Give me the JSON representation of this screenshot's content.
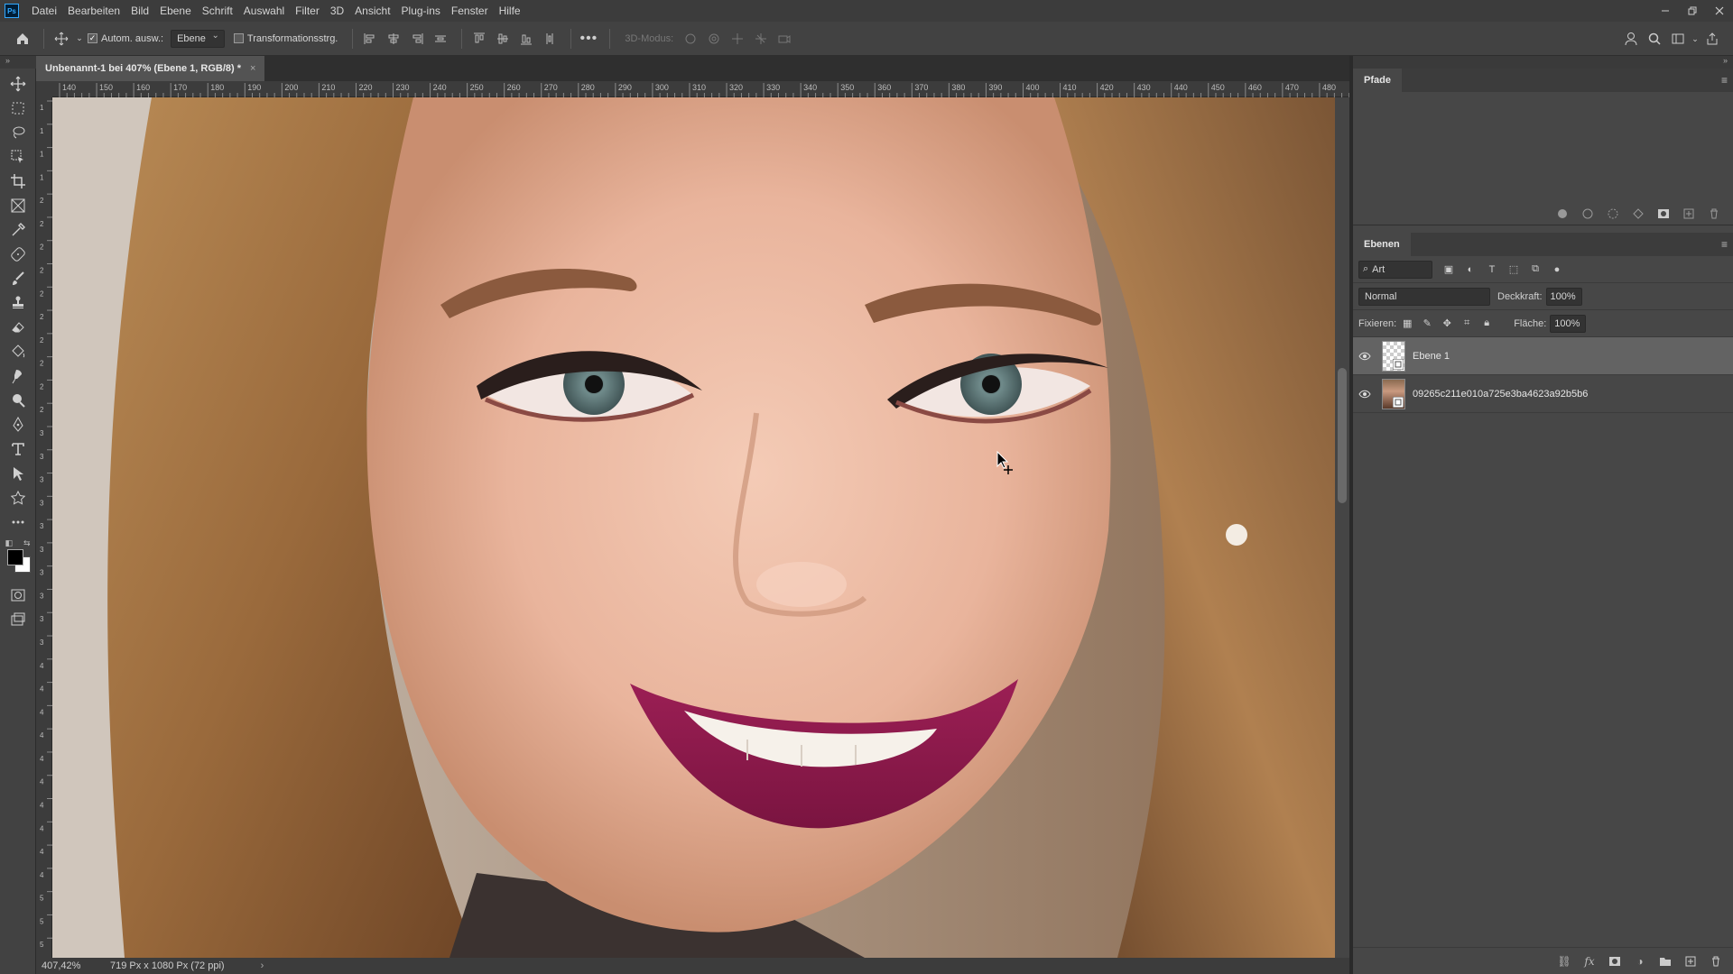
{
  "menubar": {
    "logo": "Ps",
    "items": [
      "Datei",
      "Bearbeiten",
      "Bild",
      "Ebene",
      "Schrift",
      "Auswahl",
      "Filter",
      "3D",
      "Ansicht",
      "Plug-ins",
      "Fenster",
      "Hilfe"
    ]
  },
  "optionsbar": {
    "auto_select_label": "Autom. ausw.:",
    "auto_select_checked": true,
    "auto_select_target": "Ebene",
    "transform_label": "Transformationsstrg.",
    "mode_3d_label": "3D-Modus:"
  },
  "document": {
    "tab_title": "Unbenannt-1 bei 407% (Ebene 1, RGB/8) *",
    "tab_close": "×",
    "ruler_h_labels": [
      "140",
      "150",
      "160",
      "170",
      "180",
      "190",
      "200",
      "210",
      "220",
      "230",
      "240",
      "250",
      "260",
      "270",
      "280",
      "290",
      "300",
      "310",
      "320",
      "330",
      "340",
      "350",
      "360",
      "370",
      "380",
      "390",
      "400",
      "410",
      "420",
      "430",
      "440",
      "450",
      "460",
      "470",
      "480"
    ],
    "ruler_v_labels": [
      "1",
      "1",
      "1",
      "1",
      "2",
      "2",
      "2",
      "2",
      "2",
      "2",
      "2",
      "2",
      "2",
      "2",
      "3",
      "3",
      "3",
      "3",
      "3",
      "3",
      "3",
      "3",
      "3",
      "3",
      "4",
      "4",
      "4",
      "4",
      "4",
      "4",
      "4",
      "4",
      "4",
      "4",
      "5",
      "5",
      "5"
    ]
  },
  "status": {
    "zoom": "407,42%",
    "doc_info": "719 Px x 1080 Px (72 ppi)",
    "arrow": "›"
  },
  "panels": {
    "paths": {
      "title": "Pfade"
    },
    "layers": {
      "title": "Ebenen",
      "filter_placeholder": "Art",
      "blend_mode": "Normal",
      "opacity_label": "Deckkraft:",
      "opacity_value": "100%",
      "lock_label": "Fixieren:",
      "fill_label": "Fläche:",
      "fill_value": "100%",
      "items": [
        {
          "name": "Ebene 1",
          "selected": true
        },
        {
          "name": "09265c211e010a725e3ba4623a92b5b6",
          "selected": false
        }
      ]
    }
  },
  "colors": {
    "foreground": "#000000",
    "background": "#ffffff",
    "accent": "#31a8ff",
    "ui_dark": "#3c3c3c",
    "ui_mid": "#474747",
    "ui_canvas": "#535353"
  },
  "icons": {
    "tools": [
      "move-icon",
      "marquee-icon",
      "lasso-icon",
      "object-select-icon",
      "crop-icon",
      "frame-icon",
      "eyedropper-icon",
      "healing-brush-icon",
      "brush-icon",
      "stamp-icon",
      "eraser-icon",
      "paint-bucket-icon",
      "smudge-icon",
      "dodge-icon",
      "pen-icon",
      "type-icon",
      "path-select-icon",
      "shape-icon",
      "more-tools-icon"
    ]
  }
}
